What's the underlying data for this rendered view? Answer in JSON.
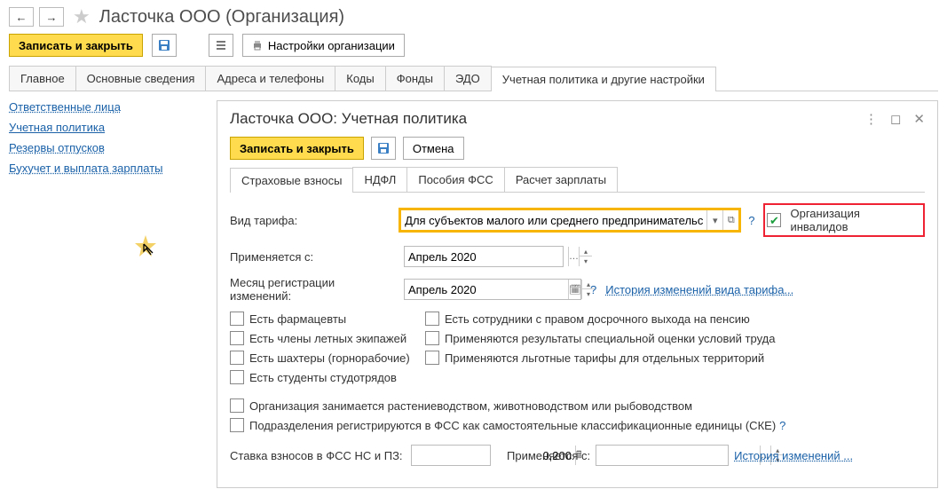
{
  "header": {
    "title": "Ласточка ООО (Организация)"
  },
  "toolbar": {
    "save_close": "Записать и закрыть",
    "settings": "Настройки организации"
  },
  "tabs": [
    "Главное",
    "Основные сведения",
    "Адреса и телефоны",
    "Коды",
    "Фонды",
    "ЭДО",
    "Учетная политика и другие настройки"
  ],
  "sidebar": {
    "items": [
      "Ответственные лица",
      "Учетная политика",
      "Резервы отпусков",
      "Бухучет и выплата зарплаты"
    ]
  },
  "panel": {
    "title": "Ласточка ООО: Учетная политика",
    "save_close": "Записать и закрыть",
    "cancel": "Отмена",
    "subtabs": [
      "Страховые взносы",
      "НДФЛ",
      "Пособия ФСС",
      "Расчет зарплаты"
    ],
    "fields": {
      "tariff_label": "Вид тарифа:",
      "tariff_value": "Для субъектов малого или среднего предпринимательс",
      "org_invalid": "Организация инвалидов",
      "applies_from_label": "Применяется с:",
      "applies_from_value": "Апрель 2020",
      "reg_month_label": "Месяц регистрации изменений:",
      "reg_month_value": "Апрель 2020",
      "history_tariff": "История изменений вида тарифа...",
      "cb_pharm": "Есть фармацевты",
      "cb_pension": "Есть сотрудники с правом досрочного выхода на пенсию",
      "cb_flight": "Есть члены летных экипажей",
      "cb_spec": "Применяются результаты специальной оценки условий труда",
      "cb_miners": "Есть шахтеры (горнорабочие)",
      "cb_lgot": "Применяются льготные тарифы для отдельных территорий",
      "cb_students": "Есть студенты студотрядов",
      "cb_agro": "Организация занимается растениеводством, животноводством или рыбоводством",
      "cb_fss": "Подразделения регистрируются в ФСС как самостоятельные классификационные единицы (СКЕ)",
      "rate_label": "Ставка взносов в ФСС НС и ПЗ:",
      "rate_value": "0,200",
      "applies_from2_label": "Применяется с:",
      "applies_from2_value": "",
      "history2": "История изменений ..."
    }
  }
}
